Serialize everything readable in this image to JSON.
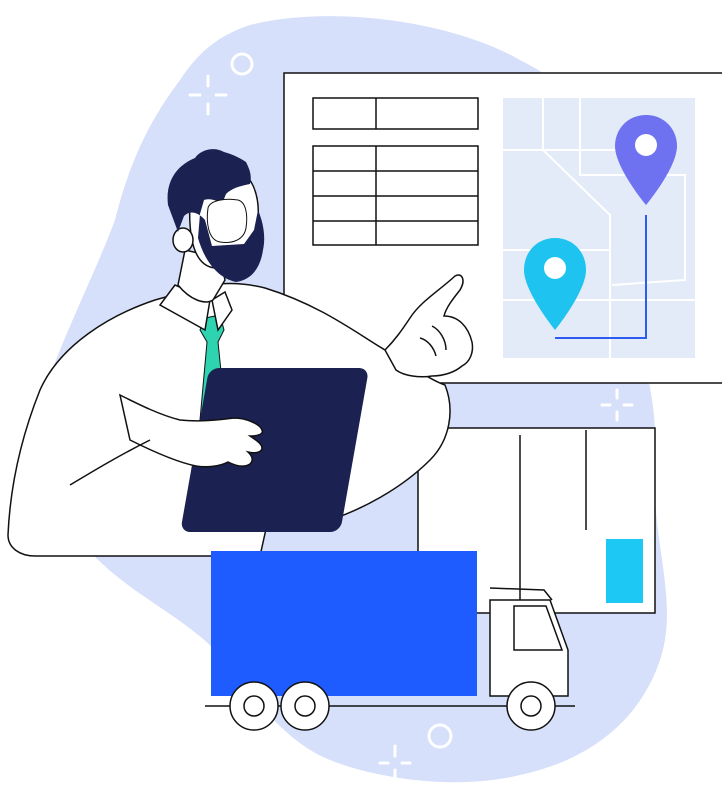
{
  "scene": {
    "subject": "logistics-manager-with-tablet",
    "colors": {
      "background": "#ffffff",
      "blob": "#d6e0fa",
      "outline": "#111111",
      "map_bg": "#e4ebf8",
      "map_roads": "#ffffff",
      "pin_violet": "#6e72f0",
      "pin_cyan": "#1ec3f0",
      "route_line": "#2f5cf0",
      "truck_cargo": "#1f5cff",
      "cabin_window_accent": "#1ec8f5",
      "tablet": "#1b2150",
      "hair_beard": "#1b2150",
      "tie": "#2ed3b0",
      "shirt": "#ffffff"
    },
    "icons": [
      "map-pin-icon",
      "sparkle-icon",
      "circle-icon",
      "truck-icon",
      "tablet-icon",
      "table-icon"
    ]
  }
}
